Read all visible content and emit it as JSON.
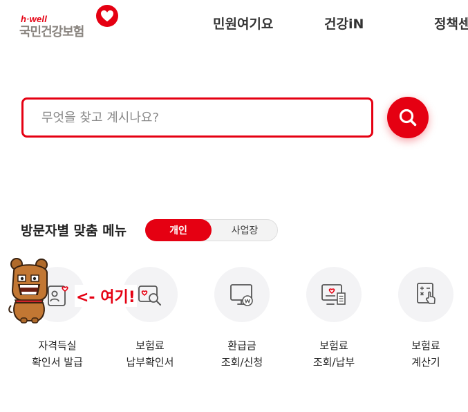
{
  "brand": {
    "tagline": "h·well",
    "name": "국민건강보험",
    "accent_color": "#e50012",
    "logo_icon": "heart-icon"
  },
  "nav": {
    "items": [
      {
        "label": "민원여기요"
      },
      {
        "label": "건강iN"
      },
      {
        "label": "정책센"
      }
    ]
  },
  "search": {
    "placeholder": "무엇을 찾고 계시나요?",
    "value": "",
    "button_icon": "search-icon"
  },
  "menu_section": {
    "title": "방문자별 맞춤 메뉴",
    "toggle": {
      "selected": "개인",
      "options": [
        "개인",
        "사업장"
      ]
    },
    "items": [
      {
        "line1": "자격득실",
        "line2": "확인서 발급",
        "icon": "certificate-icon"
      },
      {
        "line1": "보험료",
        "line2": "납부확인서",
        "icon": "document-search-icon"
      },
      {
        "line1": "환급금",
        "line2": "조회/신청",
        "icon": "refund-monitor-icon"
      },
      {
        "line1": "보험료",
        "line2": "조회/납부",
        "icon": "payment-screen-icon"
      },
      {
        "line1": "보험료",
        "line2": "계산기",
        "icon": "calculator-icon"
      }
    ]
  },
  "annotation": {
    "text": "<- 여기!"
  }
}
